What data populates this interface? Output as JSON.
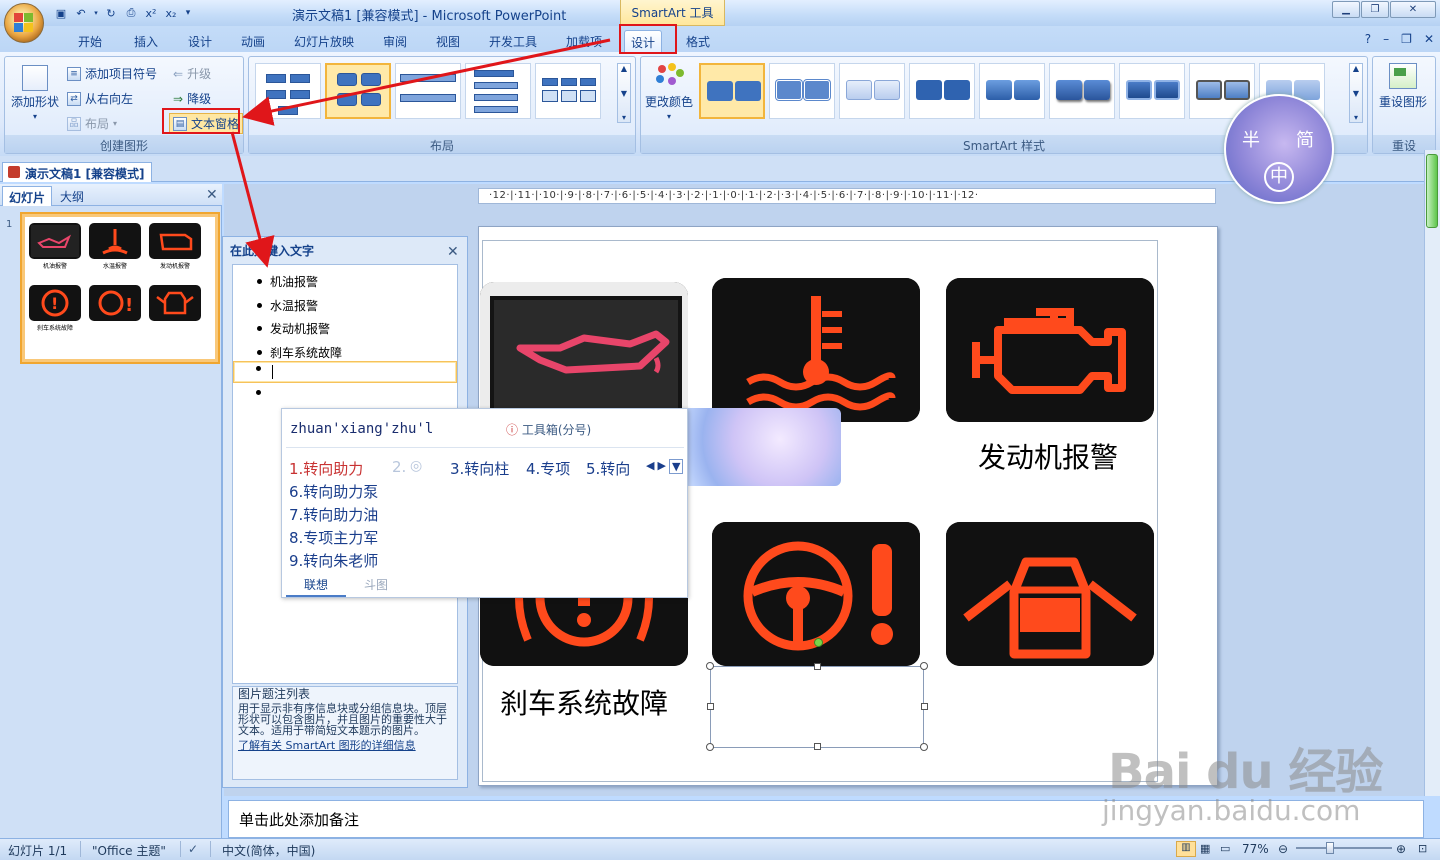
{
  "window": {
    "title": "演示文稿1 [兼容模式] - Microsoft PowerPoint",
    "contextual_tool": "SmartArt 工具"
  },
  "tabs": [
    "开始",
    "插入",
    "设计",
    "动画",
    "幻灯片放映",
    "审阅",
    "视图",
    "开发工具",
    "加载项",
    "设计",
    "格式"
  ],
  "ribbon": {
    "create_group": {
      "label": "创建图形",
      "add_shape": "添加形状",
      "add_bullet": "添加项目符号",
      "right_to_left": "从右向左",
      "layout": "布局",
      "promote": "升级",
      "demote": "降级",
      "text_pane": "文本窗格"
    },
    "layout_group": {
      "label": "布局"
    },
    "styles_group": {
      "label": "SmartArt 样式",
      "change_colors": "更改颜色"
    },
    "reset_group": {
      "label": "重设",
      "reset_graphic": "重设图形"
    }
  },
  "logo_chars": [
    "半",
    "简",
    "中"
  ],
  "document_tab": "演示文稿1 [兼容模式]",
  "left_panel": {
    "tabs": [
      "幻灯片",
      "大纲"
    ],
    "slide_number": "1",
    "thumb_labels": [
      "机油报警",
      "水温报警",
      "发动机报警",
      "刹车系统故障"
    ]
  },
  "text_pane": {
    "title": "在此处键入文字",
    "bullets": [
      "机油报警",
      "水温报警",
      "发动机报警",
      "刹车系统故障",
      "",
      ""
    ],
    "desc_title": "图片题注列表",
    "desc_body": "用于显示非有序信息块或分组信息块。顶层形状可以包含图片，并且图片的重要性大于文本。适用于带简短文本题示的图片。",
    "desc_link": "了解有关 SmartArt 图形的详细信息"
  },
  "slide": {
    "captions": [
      "发动机报警",
      "刹车系统故障"
    ],
    "partial_caption": "警"
  },
  "ime": {
    "composition": "zhuan'xiang'zhu'l",
    "hint": "工具箱(分号)",
    "candidates": [
      "1.转向助力",
      "2.",
      "3.转向柱",
      "4.专项",
      "5.转向",
      "6.转向助力泵",
      "7.转向助力油",
      "8.专项主力军",
      "9.转向朱老师"
    ],
    "tabs": [
      "联想",
      "斗图"
    ]
  },
  "notes_placeholder": "单击此处添加备注",
  "status": {
    "slide": "幻灯片 1/1",
    "theme": "\"Office 主题\"",
    "language": "中文(简体，中国)",
    "zoom": "77%"
  },
  "ruler_text": "·12·|·11·|·10·|·9·|·8·|·7·|·6·|·5·|·4·|·3·|·2·|·1·|·0·|·1·|·2·|·3·|·4·|·5·|·6·|·7·|·8·|·9·|·10·|·11·|·12·",
  "watermark": {
    "brand": "Bai  du",
    "brand_cn": "经验",
    "url": "jingyan.baidu.com"
  },
  "colors": {
    "warning": "#ff4a1c",
    "oil": "#e8456a",
    "ribbon": "#dde9fb",
    "annotation": "#e0161a"
  }
}
